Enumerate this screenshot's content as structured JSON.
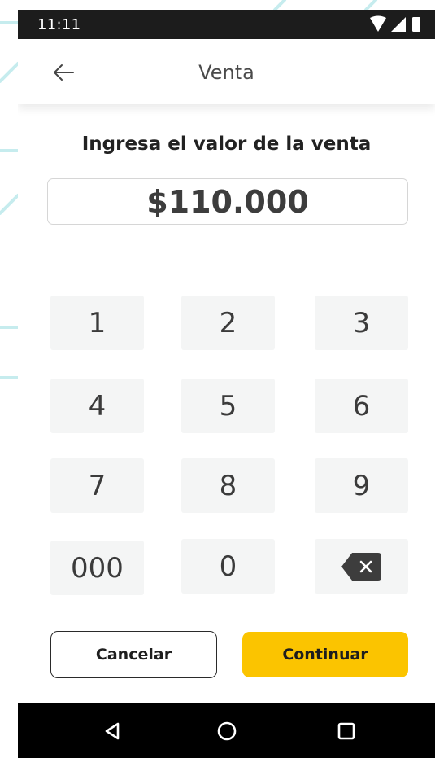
{
  "status_bar": {
    "time": "11:11",
    "icons": [
      "wifi-icon",
      "signal-icon",
      "battery-icon"
    ]
  },
  "app_bar": {
    "title": "Venta",
    "back_icon": "arrow-left-icon"
  },
  "prompt": "Ingresa el valor de la venta",
  "amount": "$110.000",
  "keypad": {
    "keys": [
      "1",
      "2",
      "3",
      "4",
      "5",
      "6",
      "7",
      "8",
      "9",
      "000",
      "0"
    ],
    "delete_icon": "backspace-icon"
  },
  "actions": {
    "cancel_label": "Cancelar",
    "continue_label": "Continuar"
  },
  "nav_bar": {
    "icons": [
      "back-triangle-icon",
      "home-circle-icon",
      "recents-square-icon"
    ]
  },
  "colors": {
    "accent": "#fbc400",
    "status_bar": "#1c1c1c",
    "nav_bar": "#000000",
    "key_bg": "#f4f5f5",
    "decoration": "#bfe9ea"
  }
}
